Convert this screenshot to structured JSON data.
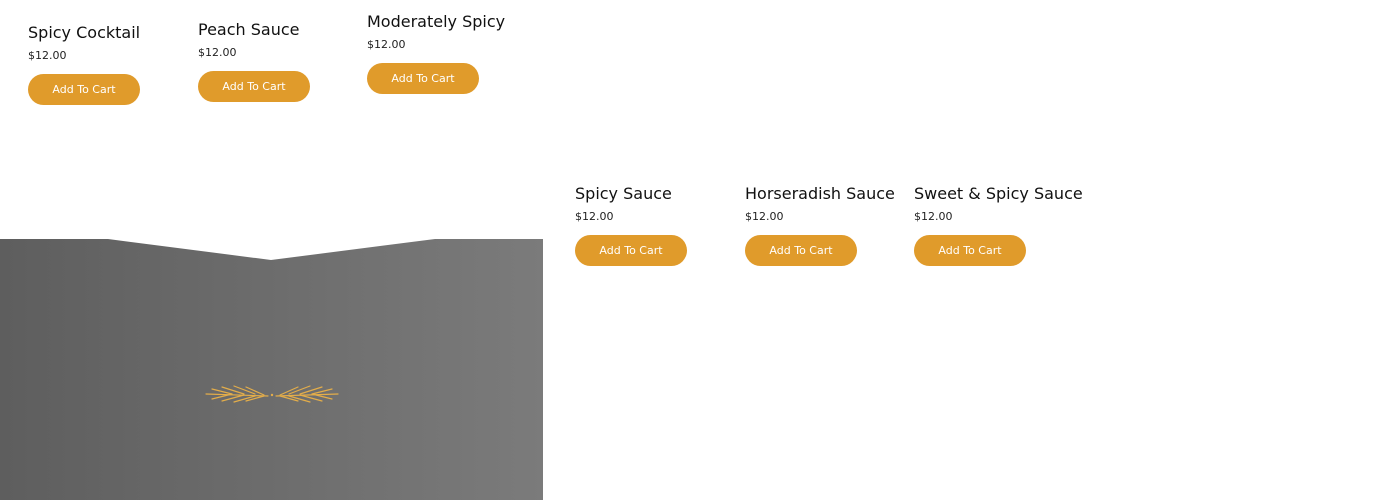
{
  "products": [
    {
      "name": "Spicy Cocktail",
      "price": "$12.00",
      "button_label": "Add To Cart"
    },
    {
      "name": "Peach Sauce",
      "price": "$12.00",
      "button_label": "Add To Cart"
    },
    {
      "name": "Moderately Spicy",
      "price": "$12.00",
      "button_label": "Add To Cart"
    },
    {
      "name": "Spicy Sauce",
      "price": "$12.00",
      "button_label": "Add To Cart"
    },
    {
      "name": "Horseradish Sauce",
      "price": "$12.00",
      "button_label": "Add To Cart"
    },
    {
      "name": "Sweet & Spicy Sauce",
      "price": "$12.00",
      "button_label": "Add To Cart"
    }
  ],
  "colors": {
    "accent": "#e09b2b",
    "panel_gradient_start": "#5e5e5e",
    "panel_gradient_end": "#7b7b7b",
    "ornament": "#e3ad4a"
  },
  "decor": {
    "panel_icon": "wheat-laurel-icon"
  }
}
